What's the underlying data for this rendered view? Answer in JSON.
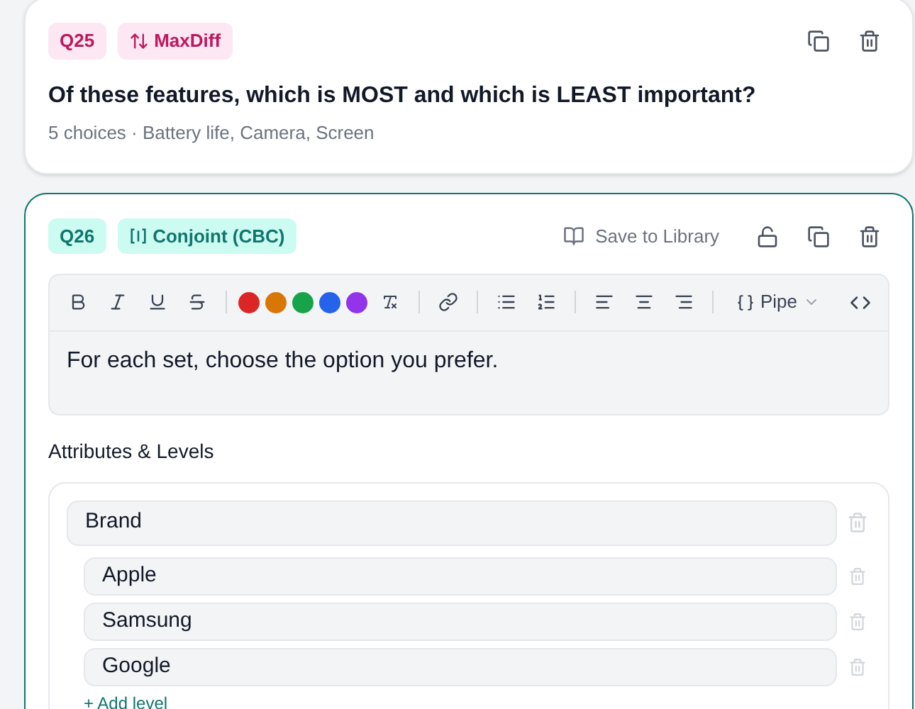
{
  "questions": [
    {
      "number": "Q25",
      "type": {
        "kind": "maxdiff",
        "label": "MaxDiff"
      },
      "selected": false,
      "title": "Of these features, which is MOST and which is LEAST important?",
      "summary": "5 choices · Battery life, Camera, Screen"
    },
    {
      "number": "Q26",
      "type": {
        "kind": "conjoint",
        "label": "Conjoint (CBC)"
      },
      "selected": true,
      "save_label": "Save to Library",
      "editor": {
        "colors": [
          {
            "color": "#dc2626"
          },
          {
            "color": "#d97706"
          },
          {
            "color": "#16a34a"
          },
          {
            "color": "#2563eb"
          },
          {
            "color": "#9333ea"
          }
        ],
        "pipe_label": "Pipe",
        "text": "For each set, choose the option you prefer."
      },
      "section_title": "Attributes & Levels",
      "attributes": [
        {
          "name": "Brand",
          "levels": [
            "Apple",
            "Samsung",
            "Google"
          ],
          "add_label": "+ Add level"
        }
      ]
    }
  ]
}
